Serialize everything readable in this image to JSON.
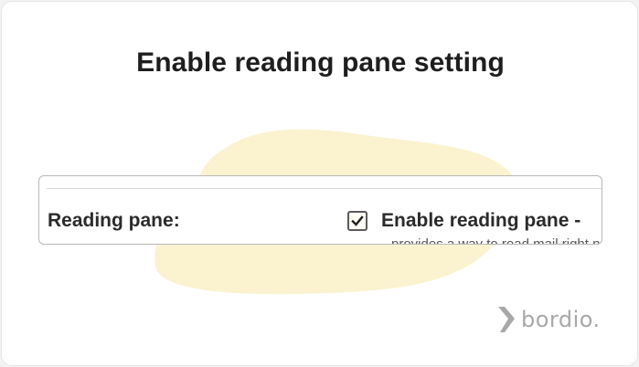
{
  "title": "Enable reading pane setting",
  "setting": {
    "label": "Reading pane:",
    "option_label": "Enable reading pane -",
    "option_desc": "provides a way to read mail right next to your list of conversations, making mail reading and writing faster and adding more context.",
    "checked": true
  },
  "brand": {
    "name": "bordio.",
    "color": "#a8a8a8"
  },
  "colors": {
    "blob": "#fbf3cf",
    "card_bg": "#ffffff",
    "title": "#1e1e1e"
  }
}
